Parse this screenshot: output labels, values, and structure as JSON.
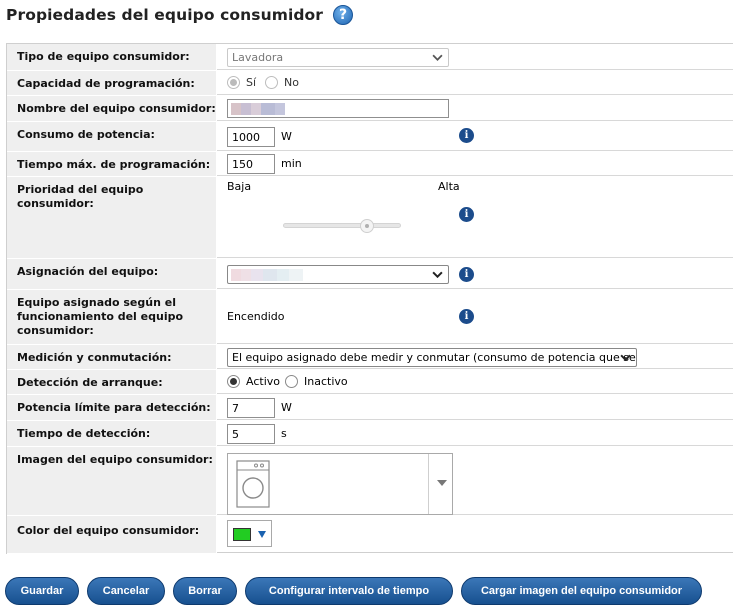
{
  "header": {
    "title": "Propiedades del equipo consumidor",
    "help_icon": "help-icon"
  },
  "form": {
    "tipo": {
      "label": "Tipo de equipo consumidor:",
      "value": "Lavadora"
    },
    "capacidad": {
      "label": "Capacidad de programación:",
      "yes": "Sí",
      "no": "No"
    },
    "nombre": {
      "label": "Nombre del equipo consumidor:"
    },
    "consumo": {
      "label": "Consumo de potencia:",
      "value": "1000",
      "unit": "W"
    },
    "tiempo_max": {
      "label": "Tiempo máx. de programación:",
      "value": "150",
      "unit": "min"
    },
    "prioridad": {
      "label": "Prioridad del equipo consumidor:",
      "low": "Baja",
      "high": "Alta"
    },
    "asignacion": {
      "label": "Asignación del equipo:"
    },
    "funcionamiento": {
      "label": "Equipo asignado según el funcionamiento del equipo consumidor:",
      "value": "Encendido"
    },
    "medicion": {
      "label": "Medición y conmutación:",
      "value": "El equipo asignado debe medir y conmutar (consumo de potencia que se puede"
    },
    "deteccion": {
      "label": "Detección de arranque:",
      "active": "Activo",
      "inactive": "Inactivo"
    },
    "potencia_limite": {
      "label": "Potencia límite para detección:",
      "value": "7",
      "unit": "W"
    },
    "tiempo_deteccion": {
      "label": "Tiempo de detección:",
      "value": "5",
      "unit": "s"
    },
    "imagen": {
      "label": "Imagen del equipo consumidor:",
      "icon": "washing-machine-icon"
    },
    "color": {
      "label": "Color del equipo consumidor:",
      "value": "#22cc22"
    }
  },
  "buttons": {
    "save": "Guardar",
    "cancel": "Cancelar",
    "delete": "Borrar",
    "time": "Configurar intervalo de tiempo",
    "upload": "Cargar imagen del equipo consumidor"
  }
}
